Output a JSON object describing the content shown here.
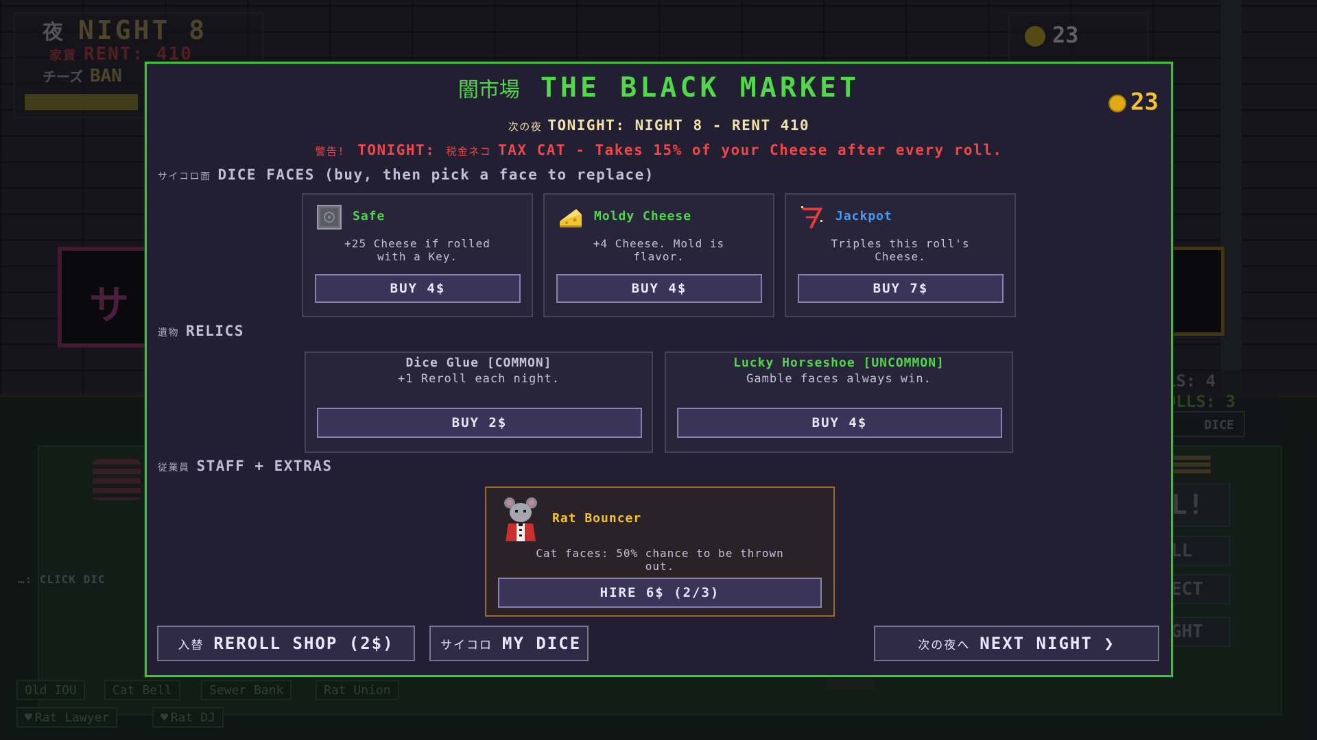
{
  "background": {
    "hud": {
      "night_jp": "夜",
      "night": "NIGHT 8",
      "rent_jp": "家賃",
      "rent": "RENT: 410",
      "bank_jp": "チーズ",
      "bank": "BAN",
      "coins": "23"
    },
    "sign_left": "サ",
    "rolls_line1": "LS: 4",
    "rolls_line2": "OLLS: 3",
    "dice_button": "DICE",
    "roll_button": "L!",
    "side_button_2": "LL",
    "side_button_3": "ECT",
    "side_button_4": "GHT",
    "hint": "…: CLICK DIC",
    "chips_row1": [
      "Old IOU",
      "Cat Bell",
      "Sewer Bank",
      "Rat Union"
    ],
    "chips_row2": [
      "Rat Lawyer",
      "Rat DJ"
    ]
  },
  "modal": {
    "title_jp": "闇市場",
    "title": "THE BLACK MARKET",
    "coins": "23",
    "tonight_jp": "次の夜",
    "tonight": "TONIGHT: NIGHT 8 - RENT 410",
    "warning_jp": "警告!",
    "warning_label": "TONIGHT:",
    "warning_cat_jp": "税金ネコ",
    "warning_text": "TAX CAT - Takes 15% of your Cheese after every roll.",
    "dice_section_jp": "サイコロ面",
    "dice_section": "DICE FACES (buy, then pick a face to replace)",
    "dice_faces": [
      {
        "icon": "safe-icon",
        "name": "Safe",
        "color": "#52d64c",
        "desc1": "+25 Cheese if rolled",
        "desc2": "with a Key.",
        "button": "BUY 4$"
      },
      {
        "icon": "cheese-icon",
        "name": "Moldy Cheese",
        "color": "#52d64c",
        "desc1": "+4 Cheese. Mold is",
        "desc2": "flavor.",
        "button": "BUY 4$"
      },
      {
        "icon": "seven-icon",
        "name": "Jackpot",
        "color": "#4a9af0",
        "desc1": "Triples this roll's",
        "desc2": "Cheese.",
        "button": "BUY 7$"
      }
    ],
    "relics_section_jp": "遺物",
    "relics_section": "RELICS",
    "relics": [
      {
        "name": "Dice Glue  [COMMON]",
        "color": "#c7c2d8",
        "desc": "+1 Reroll each night.",
        "button": "BUY 2$"
      },
      {
        "name": "Lucky Horseshoe  [UNCOMMON]",
        "color": "#52d64c",
        "desc": "Gamble faces always win.",
        "button": "BUY 4$"
      }
    ],
    "staff_section_jp": "従業員",
    "staff_section": "STAFF + EXTRAS",
    "staff": {
      "icon": "rat-bouncer-icon",
      "name": "Rat Bouncer",
      "color": "#f3c430",
      "desc1": "Cat faces: 50% chance to be thrown",
      "desc2": "out.",
      "button": "HIRE 6$ (2/3)"
    },
    "reroll_jp": "入替",
    "reroll": "REROLL SHOP (2$)",
    "mydice_jp": "サイコロ",
    "mydice": "MY DICE",
    "next_jp": "次の夜へ",
    "next": "NEXT NIGHT ❯"
  }
}
